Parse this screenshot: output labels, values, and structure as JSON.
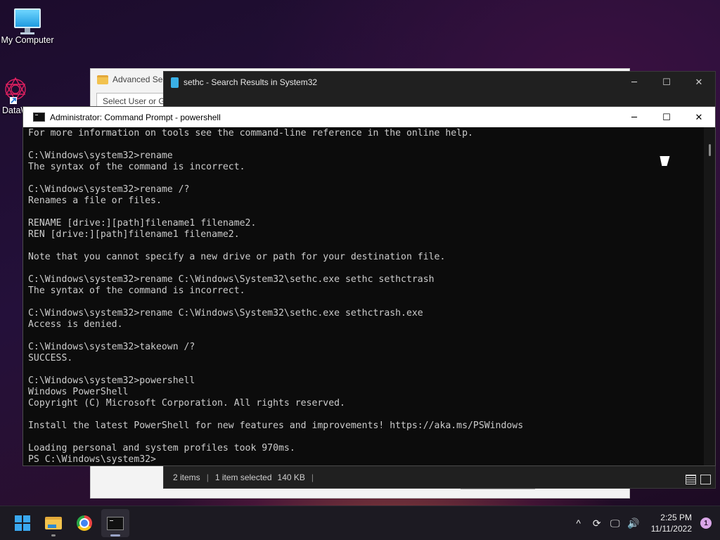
{
  "desktop": {
    "icons": [
      {
        "label": "My Computer",
        "icon": "monitor-icon"
      },
      {
        "label": "DataW",
        "icon": "datawrapper-icon"
      }
    ]
  },
  "advanced_window": {
    "title": "Advanced Sec",
    "select_text": "Select User or Gr"
  },
  "explorer_window": {
    "title": "sethc - Search Results in System32",
    "status": {
      "items": "2 items",
      "selected": "1 item selected",
      "size": "140 KB"
    }
  },
  "cmd_window": {
    "title": "Administrator: Command Prompt - powershell",
    "lines": [
      "For more information on tools see the command-line reference in the online help.",
      "",
      "C:\\Windows\\system32>rename",
      "The syntax of the command is incorrect.",
      "",
      "C:\\Windows\\system32>rename /?",
      "Renames a file or files.",
      "",
      "RENAME [drive:][path]filename1 filename2.",
      "REN [drive:][path]filename1 filename2.",
      "",
      "Note that you cannot specify a new drive or path for your destination file.",
      "",
      "C:\\Windows\\system32>rename C:\\Windows\\System32\\sethc.exe sethc sethctrash",
      "The syntax of the command is incorrect.",
      "",
      "C:\\Windows\\system32>rename C:\\Windows\\System32\\sethc.exe sethctrash.exe",
      "Access is denied.",
      "",
      "C:\\Windows\\system32>takeown /?",
      "SUCCESS.",
      "",
      "C:\\Windows\\system32>powershell",
      "Windows PowerShell",
      "Copyright (C) Microsoft Corporation. All rights reserved.",
      "",
      "Install the latest PowerShell for new features and improvements! https://aka.ms/PSWindows",
      "",
      "Loading personal and system profiles took 970ms.",
      "PS C:\\Windows\\system32>"
    ]
  },
  "taskbar": {
    "apps": [
      "start-icon",
      "file-explorer-icon",
      "chrome-icon",
      "terminal-icon"
    ],
    "clock": {
      "time": "2:25 PM",
      "date": "11/11/2022"
    },
    "notification_count": "1"
  },
  "colors": {
    "console_bg": "#0c0c0c",
    "console_fg": "#cccccc",
    "taskbar_bg": "#1c1a22",
    "accent": "#3aa8f0"
  }
}
